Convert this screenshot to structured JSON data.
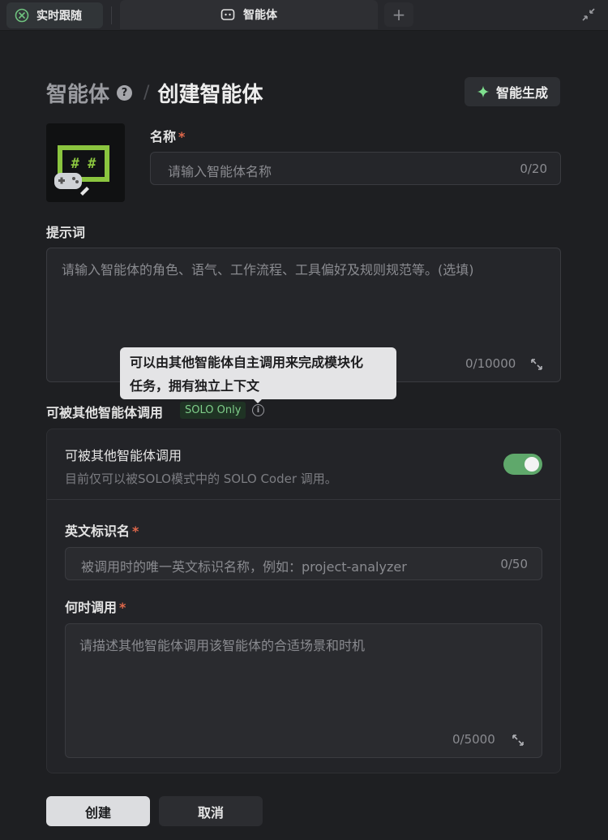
{
  "tabs": {
    "realtime_label": "实时跟随",
    "agent_label": "智能体",
    "add_label": "+"
  },
  "header": {
    "breadcrumb_root": "智能体",
    "help_glyph": "?",
    "separator": "/",
    "breadcrumb_current": "创建智能体",
    "ai_generate_label": "智能生成"
  },
  "name_field": {
    "label": "名称",
    "required_mark": "*",
    "placeholder": "请输入智能体名称",
    "counter": "0/20"
  },
  "prompt_field": {
    "label": "提示词",
    "placeholder": "请输入智能体的角色、语气、工作流程、工具偏好及规则规范等。(选填)",
    "counter": "0/10000"
  },
  "tooltip": {
    "line1": "可以由其他智能体自主调用来完成模块化",
    "line2": "任务，拥有独立上下文"
  },
  "callable_section": {
    "label": "可被其他智能体调用",
    "badge": "SOLO Only",
    "info_glyph": "i",
    "toggle_title": "可被其他智能体调用",
    "toggle_desc": "目前仅可以被SOLO模式中的 SOLO Coder 调用。",
    "toggle_on": true,
    "accent_color": "#5fa86b"
  },
  "identifier_field": {
    "label": "英文标识名",
    "required_mark": "*",
    "placeholder": "被调用时的唯一英文标识名称，例如：project-analyzer",
    "counter": "0/50"
  },
  "when_field": {
    "label": "何时调用",
    "required_mark": "*",
    "placeholder": "请描述其他智能体调用该智能体的合适场景和时机",
    "counter": "0/5000"
  },
  "actions": {
    "create_label": "创建",
    "cancel_label": "取消"
  },
  "icons": {
    "realtime": "realtime-follow-icon",
    "agent_tab": "robot-icon",
    "collapse": "collapse-icon",
    "ai_generate": "sparkle-icon",
    "expand": "expand-icon",
    "avatar": "game-console-avatar"
  }
}
